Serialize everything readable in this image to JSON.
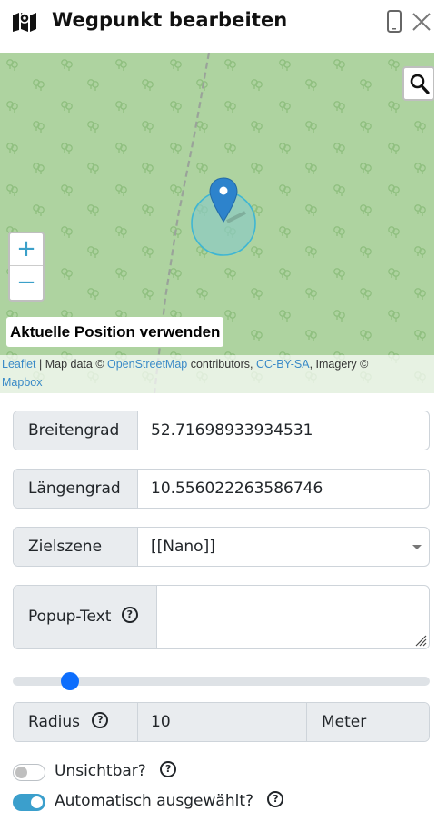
{
  "header": {
    "title": "Wegpunkt bearbeiten",
    "left_icon": "map-icon",
    "mobile_icon": "mobile-phone-icon",
    "close_icon": "close-icon"
  },
  "map": {
    "zoom_in": "+",
    "zoom_out": "−",
    "search_icon": "search-icon",
    "marker_icon": "location-pin-icon",
    "use_position_label": "Aktuelle Position verwenden",
    "attribution": {
      "leaflet": "Leaflet",
      "sep1": " | Map data © ",
      "osm": "OpenStreetMap",
      "sep2": " contributors, ",
      "license": "CC-BY-SA",
      "sep3": ", Imagery © ",
      "mapbox": "Mapbox"
    },
    "colors": {
      "background": "#aed3a0",
      "accent": "#3a8ac7"
    }
  },
  "form": {
    "latitude": {
      "label": "Breitengrad",
      "value": "52.71698933934531"
    },
    "longitude": {
      "label": "Längengrad",
      "value": "10.556022263586746"
    },
    "target_scene": {
      "label": "Zielszene",
      "selected": "[[Nano]]"
    },
    "popup_text": {
      "label": "Popup-Text",
      "help": "?",
      "value": ""
    },
    "slider": {
      "fraction": 0.12
    },
    "radius": {
      "label": "Radius",
      "help": "?",
      "value": "10",
      "unit": "Meter"
    },
    "invisible": {
      "label": "Unsichtbar?",
      "help": "?",
      "checked": false
    },
    "auto_selected": {
      "label": "Automatisch ausgewählt?",
      "help": "?",
      "checked": true
    }
  },
  "colors": {
    "primary": "#0d6efd",
    "switch_on": "#3b9fcc"
  }
}
